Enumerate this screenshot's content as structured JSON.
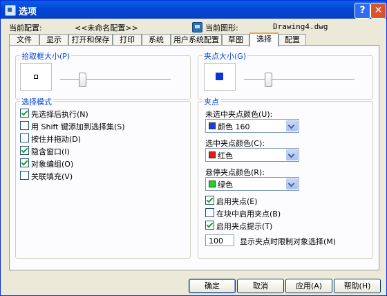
{
  "window": {
    "title": "选项",
    "help_label": "?",
    "close_label": "✕"
  },
  "header": {
    "current_profile_label": "当前配置:",
    "current_profile_value": "<<未命名配置>>",
    "current_drawing_label": "当前图形:",
    "current_drawing_value": "Drawing4.dwg",
    "drawing_icon": "drawing-file-icon"
  },
  "tabs": [
    "文件",
    "显示",
    "打开和保存",
    "打印",
    "系统",
    "用户系统配置",
    "草图",
    "选择",
    "配置"
  ],
  "active_tab": "选择",
  "pickbox": {
    "title": "拾取框大小(P)",
    "slider_fraction": 0.18
  },
  "selection_modes": {
    "title": "选择模式",
    "items": [
      {
        "label": "先选择后执行(N)",
        "checked": true
      },
      {
        "label": "用 Shift 键添加到选择集(S)",
        "checked": false
      },
      {
        "label": "按住并拖动(D)",
        "checked": false
      },
      {
        "label": "隐含窗口(I)",
        "checked": true
      },
      {
        "label": "对象编组(O)",
        "checked": true
      },
      {
        "label": "关联填充(V)",
        "checked": false
      }
    ]
  },
  "grip_size": {
    "title": "夹点大小(G)",
    "slider_fraction": 0.2,
    "color": "#0b35d6"
  },
  "grips": {
    "title": "夹点",
    "unselected_label": "未选中夹点颜色(U):",
    "unselected_value": "颜色 160",
    "unselected_color": "#1a3fd8",
    "selected_label": "选中夹点颜色(C):",
    "selected_value": "红色",
    "selected_color": "#e01a1a",
    "hover_label": "悬停夹点颜色(R):",
    "hover_value": "绿色",
    "hover_color": "#1ed41e",
    "enable_grips": {
      "label": "启用夹点(E)",
      "checked": true
    },
    "enable_in_blocks": {
      "label": "在块中启用夹点(B)",
      "checked": false
    },
    "enable_tips": {
      "label": "启用夹点提示(T)",
      "checked": true
    },
    "limit_value": "100",
    "limit_label": "显示夹点时限制对象选择(M)"
  },
  "buttons": {
    "ok": "确定",
    "cancel": "取消",
    "apply": "应用(A)",
    "help": "帮助(H)"
  }
}
